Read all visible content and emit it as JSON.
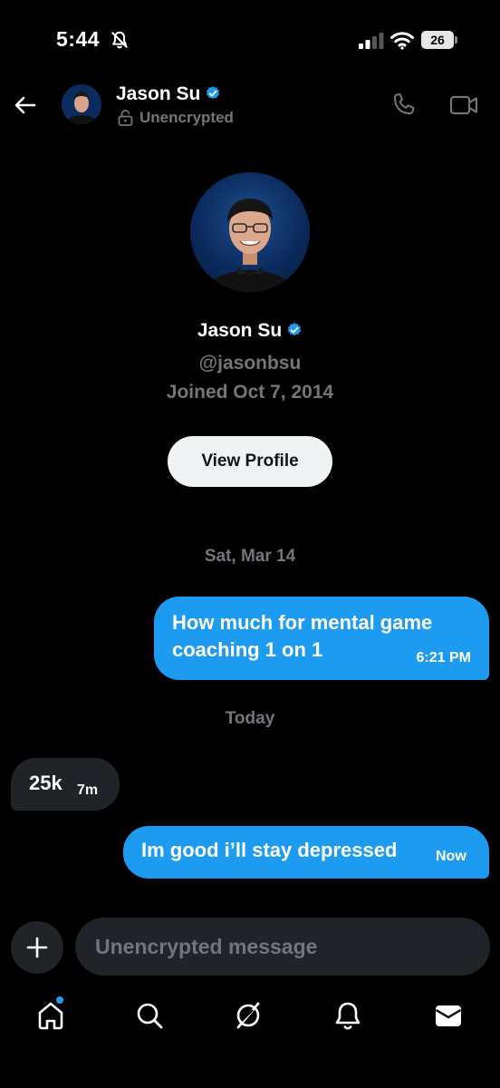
{
  "status_bar": {
    "time": "5:44",
    "battery": "26",
    "icons": [
      "bell-slash-icon",
      "signal-icon",
      "wifi-icon",
      "battery-icon"
    ]
  },
  "header": {
    "name": "Jason Su",
    "status": "Unencrypted",
    "icons": [
      "back-arrow-icon",
      "verified-badge-icon",
      "lock-open-icon",
      "phone-icon",
      "video-icon"
    ]
  },
  "profile": {
    "name": "Jason Su",
    "handle": "@jasonbsu",
    "joined": "Joined Oct 7, 2014",
    "view_profile_label": "View Profile"
  },
  "conversation": {
    "date_separators": [
      "Sat, Mar 14",
      "Today"
    ],
    "messages": [
      {
        "direction": "outgoing",
        "text": "How much for mental game coaching 1 on 1",
        "time": "6:21 PM"
      },
      {
        "direction": "incoming",
        "text": "25k",
        "time": "7m"
      },
      {
        "direction": "outgoing",
        "text": "Im good i’ll stay depressed",
        "time": "Now"
      }
    ]
  },
  "composer": {
    "placeholder": "Unencrypted message",
    "icons": [
      "plus-icon"
    ]
  },
  "bottom_nav": {
    "items": [
      "home",
      "search",
      "grok",
      "notifications",
      "messages"
    ],
    "icons": [
      "home-icon",
      "search-icon",
      "grok-icon",
      "bell-icon",
      "mail-icon"
    ]
  },
  "colors": {
    "background": "#000000",
    "accent": "#1d9bf0",
    "bubble_incoming": "#202327",
    "secondary_text": "#71767b"
  }
}
